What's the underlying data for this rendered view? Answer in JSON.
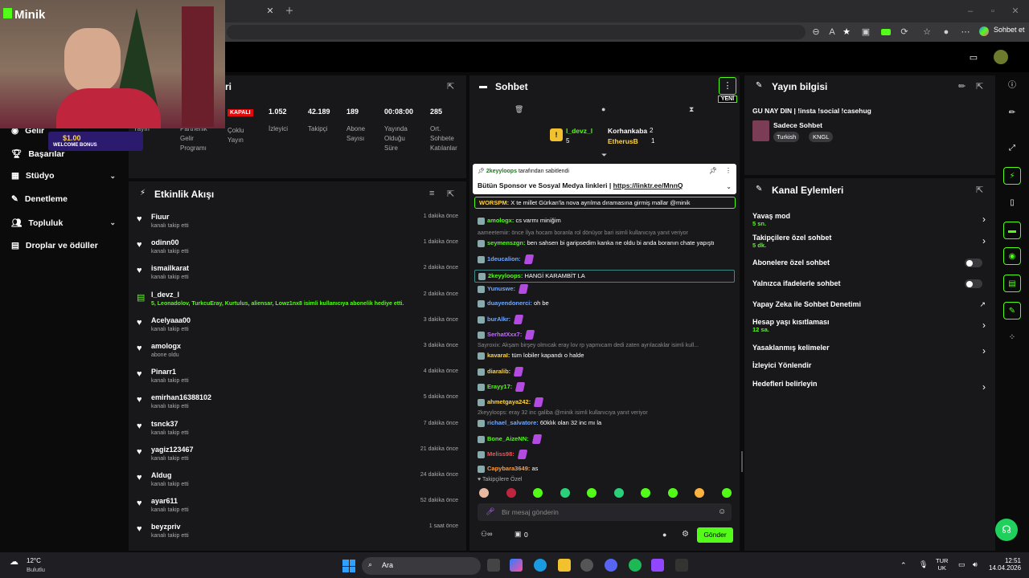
{
  "browser": {
    "sohbet_et": "Sohbet et"
  },
  "app": {
    "logo": "Minik"
  },
  "sidebar": {
    "items": [
      {
        "label": "Gelir"
      },
      {
        "label": "Başarılar"
      },
      {
        "label": "Stüdyo"
      },
      {
        "label": "Denetleme"
      },
      {
        "label": "Topluluk"
      },
      {
        "label": "Droplar ve ödüller"
      }
    ]
  },
  "stats_panel": {
    "title_fragment": "ri",
    "labels": [
      "Yayın",
      "Partnerlik Gelir Programı",
      "Çoklu Yayın",
      "İzleyici",
      "Takipçi",
      "Abone Sayısı",
      "Yayında Olduğu Süre",
      "Ort. Sohbete Katılanlar"
    ],
    "values": [
      "KAPALI",
      "1.052",
      "42.189",
      "189",
      "00:08:00",
      "285"
    ]
  },
  "activity": {
    "title": "Etkinlik Akışı",
    "items": [
      {
        "name": "Fiuur",
        "sub": "kanalı takip etti",
        "time": "1 dakika önce"
      },
      {
        "name": "odinn00",
        "sub": "kanalı takip etti",
        "time": "1 dakika önce"
      },
      {
        "name": "ismailkarat",
        "sub": "kanalı takip etti",
        "time": "2 dakika önce"
      },
      {
        "name": "l_devz_l",
        "sub": "5, Leonadolov, TurkcuEray, Kurtulus, aliensar, Lowz1nx8 isimli kullanıcıya abonelik hediye etti.",
        "time": "2 dakika önce"
      },
      {
        "name": "Acelyaaa00",
        "sub": "kanalı takip etti",
        "time": "3 dakika önce"
      },
      {
        "name": "amologx",
        "sub": "abone oldu",
        "time": "3 dakika önce"
      },
      {
        "name": "Pinarr1",
        "sub": "kanalı takip etti",
        "time": "4 dakika önce"
      },
      {
        "name": "emirhan16388102",
        "sub": "kanalı takip etti",
        "time": "5 dakika önce"
      },
      {
        "name": "tsnck37",
        "sub": "kanalı takip etti",
        "time": "7 dakika önce"
      },
      {
        "name": "yagiz123467",
        "sub": "kanalı takip etti",
        "time": "21 dakika önce"
      },
      {
        "name": "Aldug",
        "sub": "kanalı takip etti",
        "time": "24 dakika önce"
      },
      {
        "name": "ayar611",
        "sub": "kanalı takip etti",
        "time": "52 dakika önce"
      },
      {
        "name": "beyzpriv",
        "sub": "kanalı takip etti",
        "time": "1 saat önce"
      }
    ]
  },
  "chat": {
    "title": "Sohbet",
    "new_label": "YENİ",
    "top_users": [
      {
        "name": "l_devz_l",
        "count": "2",
        "sub": "5"
      },
      {
        "name": "Korhankaba",
        "count": "2"
      },
      {
        "name": "EtherusB",
        "count": "1"
      }
    ],
    "pinned": {
      "by": "2keyyloops",
      "by_suffix": "tarafından sabitlendi",
      "text": "Bütün Sponsor ve Sosyal Medya linkleri | ",
      "link": "https://linktr.ee/MnnQ"
    },
    "highlight": {
      "user": "WORSPM:",
      "text": "X te millet Gürkan'la nova ayrılma dıramasına girmiş mallar @minik"
    },
    "messages": [
      {
        "user": "amologx:",
        "text": "cs varmı miniğim",
        "color": "#53fc18"
      },
      {
        "sys": "aameetemiir: önce İlya hocam boranla rol dönüyor bari isimli kullanıcıya yanıt veriyor"
      },
      {
        "user": "seymenszgn:",
        "text": "ben sahsen bi garipsedim kanka ne oldu bi anda boranın chate yapıştı",
        "color": "#53fc18"
      },
      {
        "user": "1deucalion:",
        "text": "",
        "color": "#6fa8ff",
        "emote": true
      },
      {
        "user": "2keyyloops:",
        "text": "HANGİ KARAMBİT LA",
        "color": "#53fc18"
      },
      {
        "user": "Yunuswe:",
        "text": "",
        "color": "#6fa8ff",
        "emote": true
      },
      {
        "user": "duayendonerci:",
        "text": "oh be",
        "color": "#6fa8ff"
      },
      {
        "user": "burAlkr:",
        "text": "",
        "color": "#6fa8ff",
        "emote": true
      },
      {
        "user": "SerhatXxx7:",
        "text": "",
        "color": "#c46bff",
        "emote": true
      },
      {
        "sys": "Sayroxix: Akşam birşey olmıcak eray lov rp yapmıcam dedi zaten ayrılacaklar isimli kull..."
      },
      {
        "user": "kavaraI:",
        "text": "tüm lobiler kapandı o halde",
        "color": "#ffd23f"
      },
      {
        "user": "diaralib:",
        "text": "",
        "color": "#ffd23f",
        "emote": true
      },
      {
        "user": "Erayy17:",
        "text": "",
        "color": "#53fc18",
        "emote": true
      },
      {
        "user": "ahmetgaya242:",
        "text": "",
        "color": "#ffd23f",
        "emote": true
      },
      {
        "sys": "2keyyloops: eray 32 inc galiba @minik isimli kullanıcıya yanıt veriyor"
      },
      {
        "user": "richael_salvatore:",
        "text": "60klık olan 32 inc mı la",
        "color": "#6fa8ff"
      },
      {
        "user": "Bone_AizeNN:",
        "text": "",
        "color": "#53fc18",
        "emote": true
      },
      {
        "user": "Meliss98:",
        "text": "",
        "color": "#ff4d4d",
        "emote": true
      },
      {
        "user": "Capybara3649:",
        "text": "as",
        "color": "#ff9c3a"
      }
    ],
    "followers_only": "Takipçilere Özel",
    "placeholder": "Bir mesaj gönderin",
    "count": "0",
    "send": "Gönder"
  },
  "stream_info": {
    "title": "Yayın bilgisi",
    "stream_title": "GU NAY DIN | !insta !social !casehug",
    "category": "Sadece Sohbet",
    "tags": [
      "Turkish",
      "KNGL"
    ]
  },
  "channel_actions": {
    "title": "Kanal Eylemleri",
    "rows": [
      {
        "label": "Yavaş mod",
        "value": "5 sn.",
        "type": "arrow"
      },
      {
        "label": "Takipçilere özel sohbet",
        "value": "5 dk.",
        "type": "arrow"
      },
      {
        "label": "Abonelere özel sohbet",
        "value": "",
        "type": "toggle"
      },
      {
        "label": "Yalnızca ifadelerle sohbet",
        "value": "",
        "type": "toggle"
      },
      {
        "label": "Yapay Zeka ile Sohbet Denetimi",
        "value": "",
        "type": "ext"
      },
      {
        "label": "Hesap yaşı kısıtlaması",
        "value": "12 sa.",
        "type": "arrow"
      },
      {
        "label": "Yasaklanmış kelimeler",
        "value": "",
        "type": "arrow"
      },
      {
        "label": "İzleyici Yönlendir",
        "value": "",
        "type": "none"
      },
      {
        "label": "Hedefleri belirleyin",
        "value": "",
        "type": "arrow"
      }
    ]
  },
  "overlay": {
    "bonus_amount": "$1.00",
    "bonus_label": "WELCOME BONUS"
  },
  "taskbar": {
    "temp": "12°C",
    "weather": "Bulutlu",
    "search": "Ara",
    "lang1": "TUR",
    "lang2": "UK",
    "time": "12:51",
    "date": "14.04.2026"
  }
}
